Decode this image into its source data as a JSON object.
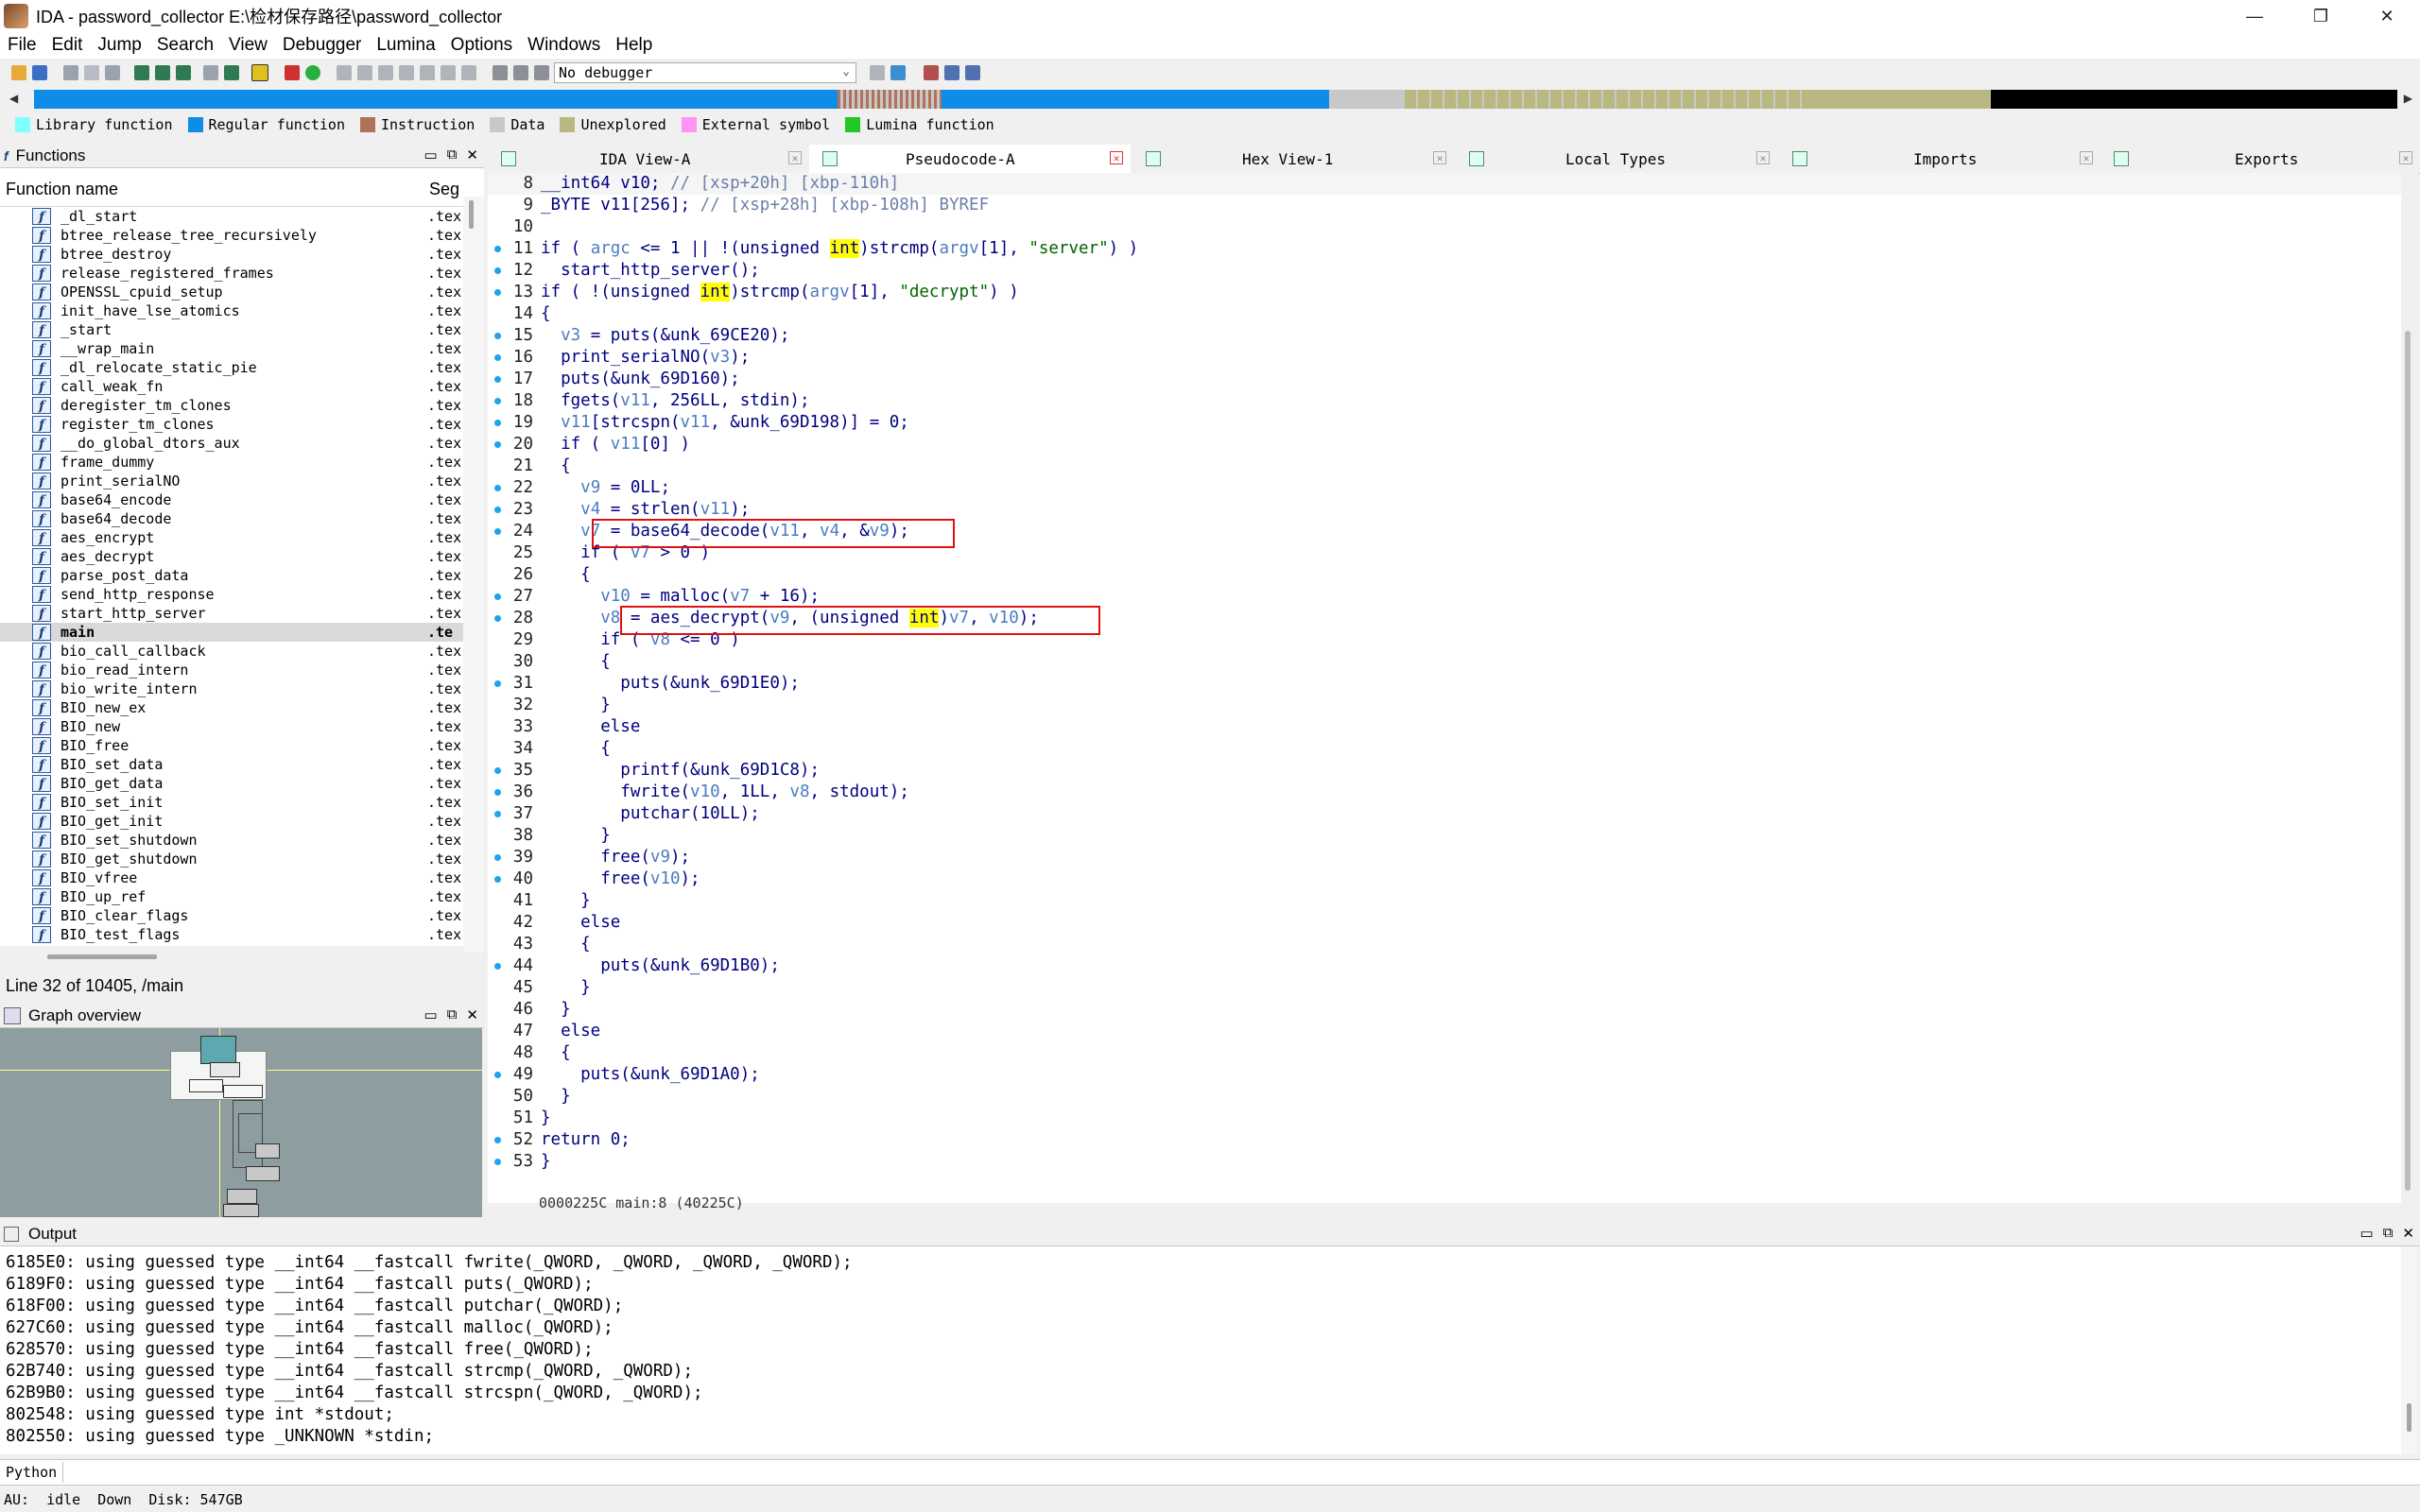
{
  "window": {
    "title": "IDA - password_collector E:\\检材保存路径\\password_collector",
    "min": "—",
    "max": "❐",
    "close": "✕"
  },
  "menu": [
    "File",
    "Edit",
    "Jump",
    "Search",
    "View",
    "Debugger",
    "Lumina",
    "Options",
    "Windows",
    "Help"
  ],
  "toolbar": {
    "debugger": "No debugger"
  },
  "legend": [
    {
      "label": "Library function",
      "color": "#7fffff"
    },
    {
      "label": "Regular function",
      "color": "#0d8ce8"
    },
    {
      "label": "Instruction",
      "color": "#b0735a"
    },
    {
      "label": "Data",
      "color": "#c8c8c8"
    },
    {
      "label": "Unexplored",
      "color": "#b8b880"
    },
    {
      "label": "External symbol",
      "color": "#ff95f0"
    },
    {
      "label": "Lumina function",
      "color": "#22c822"
    }
  ],
  "functions_panel": {
    "title": "Functions",
    "col_name": "Function name",
    "col_seg": "Seg",
    "items": [
      {
        "name": "_dl_start",
        "seg": ".tex"
      },
      {
        "name": "btree_release_tree_recursively",
        "seg": ".tex"
      },
      {
        "name": "btree_destroy",
        "seg": ".tex"
      },
      {
        "name": "release_registered_frames",
        "seg": ".tex"
      },
      {
        "name": "OPENSSL_cpuid_setup",
        "seg": ".tex"
      },
      {
        "name": "init_have_lse_atomics",
        "seg": ".tex"
      },
      {
        "name": "_start",
        "seg": ".tex"
      },
      {
        "name": "__wrap_main",
        "seg": ".tex"
      },
      {
        "name": "_dl_relocate_static_pie",
        "seg": ".tex"
      },
      {
        "name": "call_weak_fn",
        "seg": ".tex"
      },
      {
        "name": "deregister_tm_clones",
        "seg": ".tex"
      },
      {
        "name": "register_tm_clones",
        "seg": ".tex"
      },
      {
        "name": "__do_global_dtors_aux",
        "seg": ".tex"
      },
      {
        "name": "frame_dummy",
        "seg": ".tex"
      },
      {
        "name": "print_serialNO",
        "seg": ".tex"
      },
      {
        "name": "base64_encode",
        "seg": ".tex"
      },
      {
        "name": "base64_decode",
        "seg": ".tex"
      },
      {
        "name": "aes_encrypt",
        "seg": ".tex"
      },
      {
        "name": "aes_decrypt",
        "seg": ".tex"
      },
      {
        "name": "parse_post_data",
        "seg": ".tex"
      },
      {
        "name": "send_http_response",
        "seg": ".tex"
      },
      {
        "name": "start_http_server",
        "seg": ".tex"
      },
      {
        "name": "main",
        "seg": ".te"
      },
      {
        "name": "bio_call_callback",
        "seg": ".tex"
      },
      {
        "name": "bio_read_intern",
        "seg": ".tex"
      },
      {
        "name": "bio_write_intern",
        "seg": ".tex"
      },
      {
        "name": "BIO_new_ex",
        "seg": ".tex"
      },
      {
        "name": "BIO_new",
        "seg": ".tex"
      },
      {
        "name": "BIO_free",
        "seg": ".tex"
      },
      {
        "name": "BIO_set_data",
        "seg": ".tex"
      },
      {
        "name": "BIO_get_data",
        "seg": ".tex"
      },
      {
        "name": "BIO_set_init",
        "seg": ".tex"
      },
      {
        "name": "BIO_get_init",
        "seg": ".tex"
      },
      {
        "name": "BIO_set_shutdown",
        "seg": ".tex"
      },
      {
        "name": "BIO_get_shutdown",
        "seg": ".tex"
      },
      {
        "name": "BIO_vfree",
        "seg": ".tex"
      },
      {
        "name": "BIO_up_ref",
        "seg": ".tex"
      },
      {
        "name": "BIO_clear_flags",
        "seg": ".tex"
      },
      {
        "name": "BIO_test_flags",
        "seg": ".tex"
      }
    ],
    "status": "Line 32 of 10405, /main"
  },
  "graph_panel": {
    "title": "Graph overview"
  },
  "tabs": [
    {
      "label": "IDA View-A"
    },
    {
      "label": "Pseudocode-A"
    },
    {
      "label": "Hex View-1"
    },
    {
      "label": "Local Types"
    },
    {
      "label": "Imports"
    },
    {
      "label": "Exports"
    }
  ],
  "code_status": "0000225C main:8 (40225C)",
  "output_panel": {
    "title": "Output",
    "lines": [
      "6185E0: using guessed type __int64 __fastcall fwrite(_QWORD, _QWORD, _QWORD, _QWORD);",
      "6189F0: using guessed type __int64 __fastcall puts(_QWORD);",
      "618F00: using guessed type __int64 __fastcall putchar(_QWORD);",
      "627C60: using guessed type __int64 __fastcall malloc(_QWORD);",
      "628570: using guessed type __int64 __fastcall free(_QWORD);",
      "62B740: using guessed type __int64 __fastcall strcmp(_QWORD, _QWORD);",
      "62B9B0: using guessed type __int64 __fastcall strcspn(_QWORD, _QWORD);",
      "802548: using guessed type int *stdout;",
      "802550: using guessed type _UNKNOWN *stdin;"
    ]
  },
  "python_label": "Python",
  "statusbar": {
    "au": "AU:",
    "state": "idle",
    "dir": "Down",
    "disk": "Disk: 547GB"
  },
  "code": [
    {
      "n": "8",
      "bp": false,
      "parts": [
        [
          "kw",
          "__int64 v10; "
        ],
        [
          "cm",
          "// [xsp+20h] [xbp-110h]"
        ]
      ]
    },
    {
      "n": "9",
      "bp": false,
      "parts": [
        [
          "kw",
          "_BYTE v11[256]; "
        ],
        [
          "cm",
          "// [xsp+28h] [xbp-108h] BYREF"
        ]
      ]
    },
    {
      "n": "10",
      "bp": false,
      "parts": []
    },
    {
      "n": "11",
      "bp": true,
      "parts": [
        [
          "kw",
          "if ( "
        ],
        [
          "var",
          "argc"
        ],
        [
          "kw",
          " <= 1 || !(unsigned "
        ],
        [
          "hl",
          "int"
        ],
        [
          "kw",
          ")strcmp("
        ],
        [
          "var",
          "argv"
        ],
        [
          "kw",
          "[1], "
        ],
        [
          "str",
          "\"server\""
        ],
        [
          "kw",
          ") )"
        ]
      ]
    },
    {
      "n": "12",
      "bp": true,
      "parts": [
        [
          "kw",
          "  start_http_server();"
        ]
      ]
    },
    {
      "n": "13",
      "bp": true,
      "parts": [
        [
          "kw",
          "if ( !(unsigned "
        ],
        [
          "hl",
          "int"
        ],
        [
          "kw",
          ")strcmp("
        ],
        [
          "var",
          "argv"
        ],
        [
          "kw",
          "[1], "
        ],
        [
          "str",
          "\"decrypt\""
        ],
        [
          "kw",
          ") )"
        ]
      ]
    },
    {
      "n": "14",
      "bp": false,
      "parts": [
        [
          "kw",
          "{"
        ]
      ]
    },
    {
      "n": "15",
      "bp": true,
      "parts": [
        [
          "kw",
          "  "
        ],
        [
          "var",
          "v3"
        ],
        [
          "kw",
          " = puts(&unk_69CE20);"
        ]
      ]
    },
    {
      "n": "16",
      "bp": true,
      "parts": [
        [
          "kw",
          "  print_serialNO("
        ],
        [
          "var",
          "v3"
        ],
        [
          "kw",
          ");"
        ]
      ]
    },
    {
      "n": "17",
      "bp": true,
      "parts": [
        [
          "kw",
          "  puts(&unk_69D160);"
        ]
      ]
    },
    {
      "n": "18",
      "bp": true,
      "parts": [
        [
          "kw",
          "  fgets("
        ],
        [
          "var",
          "v11"
        ],
        [
          "kw",
          ", 256LL, stdin);"
        ]
      ]
    },
    {
      "n": "19",
      "bp": true,
      "parts": [
        [
          "kw",
          "  "
        ],
        [
          "var",
          "v11"
        ],
        [
          "kw",
          "[strcspn("
        ],
        [
          "var",
          "v11"
        ],
        [
          "kw",
          ", &unk_69D198)] = 0;"
        ]
      ]
    },
    {
      "n": "20",
      "bp": true,
      "parts": [
        [
          "kw",
          "  if ( "
        ],
        [
          "var",
          "v11"
        ],
        [
          "kw",
          "[0] )"
        ]
      ]
    },
    {
      "n": "21",
      "bp": false,
      "parts": [
        [
          "kw",
          "  {"
        ]
      ]
    },
    {
      "n": "22",
      "bp": true,
      "parts": [
        [
          "kw",
          "    "
        ],
        [
          "var",
          "v9"
        ],
        [
          "kw",
          " = 0LL;"
        ]
      ]
    },
    {
      "n": "23",
      "bp": true,
      "parts": [
        [
          "kw",
          "    "
        ],
        [
          "var",
          "v4"
        ],
        [
          "kw",
          " = strlen("
        ],
        [
          "var",
          "v11"
        ],
        [
          "kw",
          ");"
        ]
      ]
    },
    {
      "n": "24",
      "bp": true,
      "parts": [
        [
          "kw",
          "    "
        ],
        [
          "var",
          "v7"
        ],
        [
          "kw",
          " = base64_decode("
        ],
        [
          "var",
          "v11"
        ],
        [
          "kw",
          ", "
        ],
        [
          "var",
          "v4"
        ],
        [
          "kw",
          ", &"
        ],
        [
          "var",
          "v9"
        ],
        [
          "kw",
          ");"
        ]
      ]
    },
    {
      "n": "25",
      "bp": false,
      "parts": [
        [
          "kw",
          "    if ( "
        ],
        [
          "var",
          "v7"
        ],
        [
          "kw",
          " > 0 )"
        ]
      ]
    },
    {
      "n": "26",
      "bp": false,
      "parts": [
        [
          "kw",
          "    {"
        ]
      ]
    },
    {
      "n": "27",
      "bp": true,
      "parts": [
        [
          "kw",
          "      "
        ],
        [
          "var",
          "v10"
        ],
        [
          "kw",
          " = malloc("
        ],
        [
          "var",
          "v7"
        ],
        [
          "kw",
          " + 16);"
        ]
      ]
    },
    {
      "n": "28",
      "bp": true,
      "parts": [
        [
          "kw",
          "      "
        ],
        [
          "var",
          "v8"
        ],
        [
          "kw",
          " = aes_decrypt("
        ],
        [
          "var",
          "v9"
        ],
        [
          "kw",
          ", (unsigned "
        ],
        [
          "hl",
          "int"
        ],
        [
          "kw",
          ")"
        ],
        [
          "var",
          "v7"
        ],
        [
          "kw",
          ", "
        ],
        [
          "var",
          "v10"
        ],
        [
          "kw",
          ");"
        ]
      ]
    },
    {
      "n": "29",
      "bp": false,
      "parts": [
        [
          "kw",
          "      if ( "
        ],
        [
          "var",
          "v8"
        ],
        [
          "kw",
          " <= 0 )"
        ]
      ]
    },
    {
      "n": "30",
      "bp": false,
      "parts": [
        [
          "kw",
          "      {"
        ]
      ]
    },
    {
      "n": "31",
      "bp": true,
      "parts": [
        [
          "kw",
          "        puts(&unk_69D1E0);"
        ]
      ]
    },
    {
      "n": "32",
      "bp": false,
      "parts": [
        [
          "kw",
          "      }"
        ]
      ]
    },
    {
      "n": "33",
      "bp": false,
      "parts": [
        [
          "kw",
          "      else"
        ]
      ]
    },
    {
      "n": "34",
      "bp": false,
      "parts": [
        [
          "kw",
          "      {"
        ]
      ]
    },
    {
      "n": "35",
      "bp": true,
      "parts": [
        [
          "kw",
          "        printf(&unk_69D1C8);"
        ]
      ]
    },
    {
      "n": "36",
      "bp": true,
      "parts": [
        [
          "kw",
          "        fwrite("
        ],
        [
          "var",
          "v10"
        ],
        [
          "kw",
          ", 1LL, "
        ],
        [
          "var",
          "v8"
        ],
        [
          "kw",
          ", stdout);"
        ]
      ]
    },
    {
      "n": "37",
      "bp": true,
      "parts": [
        [
          "kw",
          "        putchar(10LL);"
        ]
      ]
    },
    {
      "n": "38",
      "bp": false,
      "parts": [
        [
          "kw",
          "      }"
        ]
      ]
    },
    {
      "n": "39",
      "bp": true,
      "parts": [
        [
          "kw",
          "      free("
        ],
        [
          "var",
          "v9"
        ],
        [
          "kw",
          ");"
        ]
      ]
    },
    {
      "n": "40",
      "bp": true,
      "parts": [
        [
          "kw",
          "      free("
        ],
        [
          "var",
          "v10"
        ],
        [
          "kw",
          ");"
        ]
      ]
    },
    {
      "n": "41",
      "bp": false,
      "parts": [
        [
          "kw",
          "    }"
        ]
      ]
    },
    {
      "n": "42",
      "bp": false,
      "parts": [
        [
          "kw",
          "    else"
        ]
      ]
    },
    {
      "n": "43",
      "bp": false,
      "parts": [
        [
          "kw",
          "    {"
        ]
      ]
    },
    {
      "n": "44",
      "bp": true,
      "parts": [
        [
          "kw",
          "      puts(&unk_69D1B0);"
        ]
      ]
    },
    {
      "n": "45",
      "bp": false,
      "parts": [
        [
          "kw",
          "    }"
        ]
      ]
    },
    {
      "n": "46",
      "bp": false,
      "parts": [
        [
          "kw",
          "  }"
        ]
      ]
    },
    {
      "n": "47",
      "bp": false,
      "parts": [
        [
          "kw",
          "  else"
        ]
      ]
    },
    {
      "n": "48",
      "bp": false,
      "parts": [
        [
          "kw",
          "  {"
        ]
      ]
    },
    {
      "n": "49",
      "bp": true,
      "parts": [
        [
          "kw",
          "    puts(&unk_69D1A0);"
        ]
      ]
    },
    {
      "n": "50",
      "bp": false,
      "parts": [
        [
          "kw",
          "  }"
        ]
      ]
    },
    {
      "n": "51",
      "bp": false,
      "parts": [
        [
          "kw",
          "}"
        ]
      ]
    },
    {
      "n": "52",
      "bp": true,
      "parts": [
        [
          "kw",
          "return 0;"
        ]
      ]
    },
    {
      "n": "53",
      "bp": true,
      "parts": [
        [
          "kw",
          "}"
        ]
      ]
    }
  ]
}
